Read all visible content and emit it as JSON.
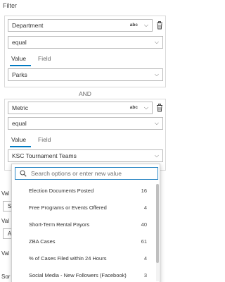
{
  "header": {
    "title": "Filter"
  },
  "clause1": {
    "field": "Department",
    "field_type_badge": "abc",
    "operator": "equal",
    "tabs": [
      {
        "label": "Value"
      },
      {
        "label": "Field"
      }
    ],
    "value": "Parks"
  },
  "connector": "AND",
  "clause2": {
    "field": "Metric",
    "field_type_badge": "abc",
    "operator": "equal",
    "tabs": [
      {
        "label": "Value"
      },
      {
        "label": "Field"
      }
    ],
    "value": "KSC Tournament Teams"
  },
  "dropdown": {
    "search_placeholder": "Search options or enter new value",
    "options": [
      {
        "label": "Election Documents Posted",
        "count": "16"
      },
      {
        "label": "Free Programs or Events Offered",
        "count": "4"
      },
      {
        "label": "Short-Term Rental Payors",
        "count": "40"
      },
      {
        "label": "ZBA Cases",
        "count": "61"
      },
      {
        "label": "% of Cases Filed within 24 Hours",
        "count": "4"
      },
      {
        "label": "Social Media - New Followers (Facebook)",
        "count": "3"
      }
    ]
  },
  "background_fragments": {
    "val1": "Val",
    "s": "S",
    "val2": "Val",
    "a": "A",
    "val3": "Val",
    "sort": "Sor"
  },
  "icons": {
    "trash": "trash-icon",
    "chevron": "chevron-down-icon",
    "search": "search-icon"
  },
  "colors": {
    "accent": "#007ac2",
    "search_border": "#2b86c4",
    "border": "#b8b8b8"
  }
}
